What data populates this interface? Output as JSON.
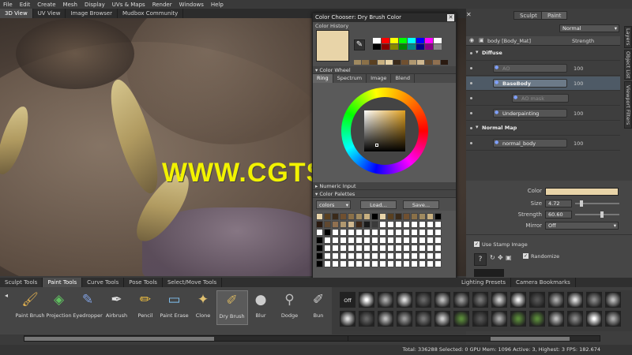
{
  "menu": [
    "File",
    "Edit",
    "Create",
    "Mesh",
    "Display",
    "UVs & Maps",
    "Render",
    "Windows",
    "Help"
  ],
  "view_tabs": [
    "3D View",
    "UV View",
    "Image Browser",
    "Mudbox Community"
  ],
  "watermark": "WWW.CGTSJ.COM",
  "chooser": {
    "title": "Color Chooser: Dry Brush Color",
    "history_label": "Color History",
    "wheel_label": "Color Wheel",
    "wheel_tabs": [
      "Ring",
      "Spectrum",
      "Image",
      "Blend"
    ],
    "numeric_label": "Numeric Input",
    "palettes_label": "Color Palettes",
    "palette_select": "colors",
    "load_label": "Load...",
    "save_label": "Save...",
    "current_color": "#e8d4a8"
  },
  "right_panel": {
    "tabs": [
      "Sculpt",
      "Paint"
    ],
    "blend_mode": "Normal",
    "header_layer": "body [Body_Mat]",
    "header_col": "Strength",
    "layers": [
      {
        "name": "Diffuse",
        "group": true,
        "value": ""
      },
      {
        "name": "AO",
        "group": false,
        "value": "100"
      },
      {
        "name": "BaseBody",
        "group": false,
        "value": "100"
      },
      {
        "name": "AO mask",
        "group": false,
        "value": ""
      },
      {
        "name": "Underpainting",
        "group": false,
        "value": "100"
      },
      {
        "name": "Normal Map",
        "group": true,
        "value": ""
      },
      {
        "name": "normal_body",
        "group": false,
        "value": "100"
      }
    ],
    "side_tabs": [
      "Layers",
      "Object List",
      "Viewport Filters"
    ],
    "props": {
      "color_label": "Color",
      "color_value": "#e8d4a8",
      "size_label": "Size",
      "size_value": "4.72",
      "strength_label": "Strength",
      "strength_value": "60.60",
      "mirror_label": "Mirror",
      "mirror_value": "Off",
      "stamp_label": "Use Stamp Image",
      "randomize_label": "Randomize"
    }
  },
  "tool_tabs": [
    "Sculpt Tools",
    "Paint Tools",
    "Curve Tools",
    "Pose Tools",
    "Select/Move Tools"
  ],
  "tools": [
    "Paint Brush",
    "Projection",
    "Eyedropper",
    "Airbrush",
    "Pencil",
    "Paint Erase",
    "Clone",
    "Dry Brush",
    "Blur",
    "Dodge",
    "Bun"
  ],
  "stamp_tabs": [
    "Lighting Presets",
    "Camera Bookmarks"
  ],
  "stamp_off": "Off",
  "status": "Total: 336288  Selected: 0  GPU Mem: 1096  Active: 3, Highest: 3  FPS: 182.674"
}
